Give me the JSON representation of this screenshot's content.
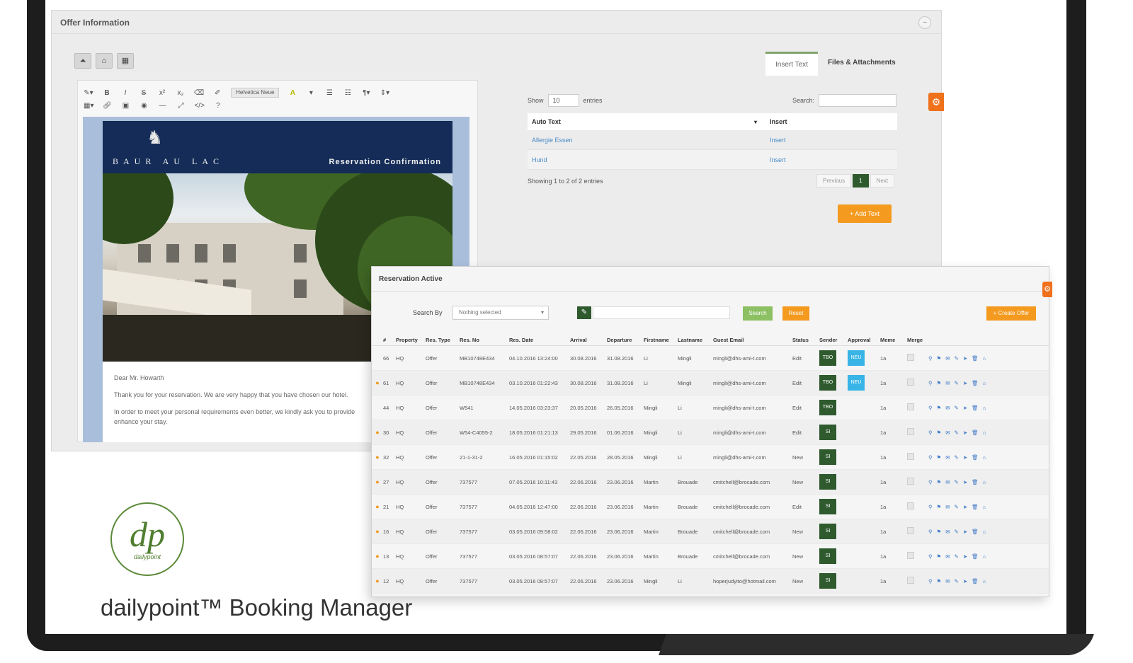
{
  "offer": {
    "title": "Offer Information",
    "tabs": [
      "Insert Text",
      "Files & Attachments"
    ],
    "email": {
      "brand": "BAUR AU LAC",
      "heading": "Reservation Confirmation",
      "salutation": "Dear Mr. Howarth",
      "line1": "Thank you for your reservation. We are very happy that you have chosen our hotel.",
      "line2": "In order to meet your personal requirements even better, we kindly ask you to provide",
      "line3": "enhance your stay."
    },
    "editor": {
      "font_label": "Helvetica Neue"
    },
    "insert_table": {
      "show_label": "Show",
      "show_value": "10",
      "entries_label": "entries",
      "search_label": "Search:",
      "col_auto_text": "Auto Text",
      "col_insert": "Insert",
      "rows": [
        {
          "name": "Allergie Essen",
          "action": "Insert"
        },
        {
          "name": "Hund",
          "action": "Insert"
        }
      ],
      "info": "Showing 1 to 2 of 2 entries",
      "pager": {
        "prev": "Previous",
        "current": "1",
        "next": "Next"
      },
      "add_button": "+ Add Text"
    }
  },
  "reservation": {
    "title": "Reservation Active",
    "search_by": "Search By",
    "select_placeholder": "Nothing selected",
    "search_button": "Search",
    "reset_button": "Reset",
    "create_button": "+ Create Offer",
    "columns": [
      "#",
      "Property",
      "Res. Type",
      "Res. No",
      "Res. Date",
      "Arrival",
      "Departure",
      "Firstname",
      "Lastname",
      "Guest Email",
      "Status",
      "Sender",
      "Approval",
      "Meme",
      "Merge"
    ],
    "rows": [
      {
        "star": false,
        "n": "66",
        "prop": "HQ",
        "type": "Offer",
        "no": "MB10748E434",
        "date": "04.10.2016 13:24:00",
        "arr": "30.08.2016",
        "dep": "31.08.2016",
        "fn": "Li",
        "ln": "Mingli",
        "mail": "mingli@dhs-ami-t.com",
        "st": "Edit",
        "snd": "TBO",
        "app": "NEU",
        "me": "1a"
      },
      {
        "star": true,
        "n": "61",
        "prop": "HQ",
        "type": "Offer",
        "no": "MB10748E434",
        "date": "03.10.2016 01:22:43",
        "arr": "30.08.2016",
        "dep": "31.08.2016",
        "fn": "Li",
        "ln": "Mingli",
        "mail": "mingli@dhs-ami-t.com",
        "st": "Edit",
        "snd": "TBO",
        "app": "NEU",
        "me": "1a"
      },
      {
        "star": false,
        "n": "44",
        "prop": "HQ",
        "type": "Offer",
        "no": "W541",
        "date": "14.05.2016 03:23:37",
        "arr": "20.05.2016",
        "dep": "26.05.2016",
        "fn": "Mingli",
        "ln": "Li",
        "mail": "mingli@dhs-ami-t.com",
        "st": "Edit",
        "snd": "TBO",
        "app": "",
        "me": "1a"
      },
      {
        "star": true,
        "n": "30",
        "prop": "HQ",
        "type": "Offer",
        "no": "W54-C4055-2",
        "date": "18.05.2016 01:21:13",
        "arr": "29.05.2016",
        "dep": "01.06.2016",
        "fn": "Mingli",
        "ln": "Li",
        "mail": "mingli@dhs-ami-t.com",
        "st": "Edit",
        "snd": "SI",
        "app": "",
        "me": "1a"
      },
      {
        "star": true,
        "n": "32",
        "prop": "HQ",
        "type": "Offer",
        "no": "21-1-31-2",
        "date": "16.05.2016 01:15:02",
        "arr": "22.05.2016",
        "dep": "28.05.2016",
        "fn": "Mingli",
        "ln": "Li",
        "mail": "mingli@dhs-ami-t.com",
        "st": "New",
        "snd": "SI",
        "app": "",
        "me": "1a"
      },
      {
        "star": true,
        "n": "27",
        "prop": "HQ",
        "type": "Offer",
        "no": "737577",
        "date": "07.05.2016 10:11:43",
        "arr": "22.06.2016",
        "dep": "23.06.2016",
        "fn": "Martin",
        "ln": "Brouade",
        "mail": "cmitchell@brocade.com",
        "st": "New",
        "snd": "SI",
        "app": "",
        "me": "1a"
      },
      {
        "star": true,
        "n": "21",
        "prop": "HQ",
        "type": "Offer",
        "no": "737577",
        "date": "04.05.2016 12:47:00",
        "arr": "22.06.2016",
        "dep": "23.06.2016",
        "fn": "Martin",
        "ln": "Brouade",
        "mail": "cmitchell@brocade.com",
        "st": "Edit",
        "snd": "SI",
        "app": "",
        "me": "1a"
      },
      {
        "star": true,
        "n": "16",
        "prop": "HQ",
        "type": "Offer",
        "no": "737577",
        "date": "03.05.2016 09:58:02",
        "arr": "22.06.2016",
        "dep": "23.06.2016",
        "fn": "Martin",
        "ln": "Brouade",
        "mail": "cmitchell@brocade.com",
        "st": "New",
        "snd": "SI",
        "app": "",
        "me": "1a"
      },
      {
        "star": true,
        "n": "13",
        "prop": "HQ",
        "type": "Offer",
        "no": "737577",
        "date": "03.05.2016 08:57:07",
        "arr": "22.06.2016",
        "dep": "23.06.2016",
        "fn": "Martin",
        "ln": "Brouade",
        "mail": "cmitchell@brocade.com",
        "st": "New",
        "snd": "SI",
        "app": "",
        "me": "1a"
      },
      {
        "star": true,
        "n": "12",
        "prop": "HQ",
        "type": "Offer",
        "no": "737577",
        "date": "03.05.2016 08:57:07",
        "arr": "22.06.2016",
        "dep": "23.06.2016",
        "fn": "Mingli",
        "ln": "Li",
        "mail": "hoperjudyito@hotmail.com",
        "st": "New",
        "snd": "SI",
        "app": "",
        "me": "1a"
      }
    ],
    "action_icons": [
      "search-icon",
      "flag-icon",
      "mail-icon",
      "edit-icon",
      "send-icon",
      "trash-icon",
      "home-icon"
    ]
  },
  "branding": {
    "logo_script": "dp",
    "logo_word": "dailypoint",
    "caption": "dailypoint™ Booking Manager"
  },
  "colors": {
    "accent_orange": "#f39a1f",
    "dark_green": "#2e5a2e",
    "light_green": "#8cc063",
    "badge_blue": "#38b4e6",
    "email_header_navy": "#142c57",
    "link_blue": "#4a8bc8"
  }
}
